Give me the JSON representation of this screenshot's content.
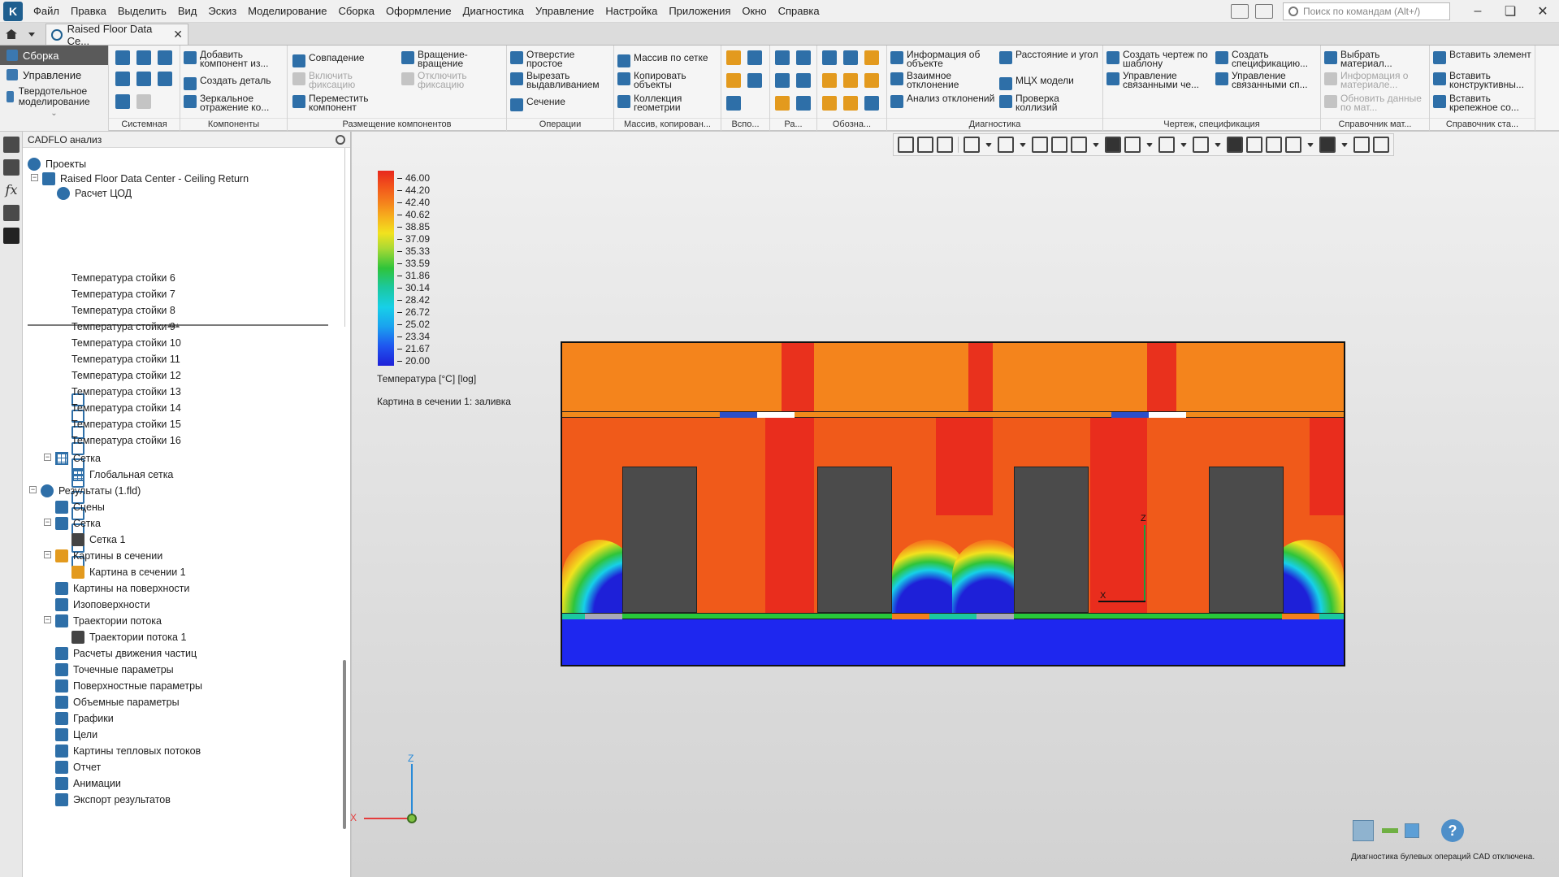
{
  "menubar": {
    "items": [
      "Файл",
      "Правка",
      "Выделить",
      "Вид",
      "Эскиз",
      "Моделирование",
      "Сборка",
      "Оформление",
      "Диагностика",
      "Управление",
      "Настройка",
      "Приложения",
      "Окно",
      "Справка"
    ],
    "search_placeholder": "Поиск по командам (Alt+/)"
  },
  "tabs": {
    "doc_title": "Raised Floor Data Ce..."
  },
  "ribbon": {
    "modes": {
      "assembly": "Сборка",
      "management": "Управление",
      "solid": "Твердотельное моделирование"
    },
    "groups": {
      "system": "Системная",
      "components": "Компоненты",
      "placement": "Размещение компонентов",
      "operations": "Операции",
      "array": "Массив, копирован...",
      "aux": "Вспо...",
      "ra": "Ра...",
      "designation": "Обозна...",
      "diagnostics": "Диагностика",
      "drawing": "Чертеж, спецификация",
      "material_ref": "Справочник мат...",
      "std_ref": "Справочник ста..."
    },
    "commands": {
      "add_component": "Добавить компонент из...",
      "create_part": "Создать деталь",
      "mirror": "Зеркальное отражение ко...",
      "coincidence": "Совпадение",
      "enable_fix": "Включить фиксацию",
      "move_component": "Переместить компонент",
      "rotation": "Вращение-вращение",
      "disable_fix": "Отключить фиксацию",
      "simple_hole": "Отверстие простое",
      "extrude_cut": "Вырезать выдавливанием",
      "section": "Сечение",
      "grid_array": "Массив по сетке",
      "copy_objects": "Копировать объекты",
      "geometry_collection": "Коллекция геометрии",
      "object_info": "Информация об объекте",
      "mutual_deviation": "Взаимное отклонение",
      "deviation_analysis": "Анализ отклонений",
      "distance_angle": "Расстояние и угол",
      "mass_props": "МЦХ модели",
      "collision_check": "Проверка коллизий",
      "template_drawing": "Создать чертеж по шаблону",
      "linked_control": "Управление связанными че...",
      "create_spec": "Создать спецификацию...",
      "linked_spec": "Управление связанными сп...",
      "pick_material": "Выбрать материал...",
      "material_info": "Информация о материале...",
      "update_material": "Обновить данные по мат...",
      "insert_element": "Вставить элемент",
      "insert_struct": "Вставить конструктивны...",
      "insert_fastener": "Вставить крепежное со..."
    }
  },
  "panel": {
    "title": "CADFLO анализ",
    "tree": {
      "projects": "Проекты",
      "project_name": "Raised Floor Data Center - Ceiling Return",
      "calc": "Расчет ЦОД",
      "racks": [
        "Температура стойки 6",
        "Температура стойки 7",
        "Температура стойки 8",
        "Температура стойки 9",
        "Температура стойки 10",
        "Температура стойки 11",
        "Температура стойки 12",
        "Температура стойки 13",
        "Температура стойки 14",
        "Температура стойки 15",
        "Температура стойки 16"
      ],
      "mesh": "Сетка",
      "global_mesh": "Глобальная сетка",
      "results": "Результаты (1.fld)",
      "scenes": "Сцены",
      "mesh2": "Сетка",
      "mesh1": "Сетка 1",
      "section_pics": "Картины в сечении",
      "section_pic1": "Картина в сечении 1",
      "surface_pics": "Картины на поверхности",
      "isosurfaces": "Изоповерхности",
      "flow_traj": "Траектории потока",
      "flow_traj1": "Траектории потока 1",
      "particles": "Расчеты движения частиц",
      "point_params": "Точечные параметры",
      "surface_params": "Поверхностные параметры",
      "volume_params": "Объемные параметры",
      "graphs": "Графики",
      "goals": "Цели",
      "heat_flux": "Картины тепловых потоков",
      "report": "Отчет",
      "animations": "Анимации",
      "export": "Экспорт результатов"
    }
  },
  "legend": {
    "ticks": [
      "46.00",
      "44.20",
      "42.40",
      "40.62",
      "38.85",
      "37.09",
      "35.33",
      "33.59",
      "31.86",
      "30.14",
      "28.42",
      "26.72",
      "25.02",
      "23.34",
      "21.67",
      "20.00"
    ],
    "title": "Температура [°C] [log]",
    "section_label": "Картина в сечении 1: заливка",
    "colors": {
      "hot": "#e8281e",
      "warm": "#f5801c",
      "mid": "#2fc43a",
      "cool": "#17d0e8",
      "cold": "#1e20d8"
    }
  },
  "triad": {
    "z": "Z",
    "x": "X"
  },
  "status": {
    "text": "Диагностика булевых операций CAD отключена.",
    "help": "?"
  }
}
